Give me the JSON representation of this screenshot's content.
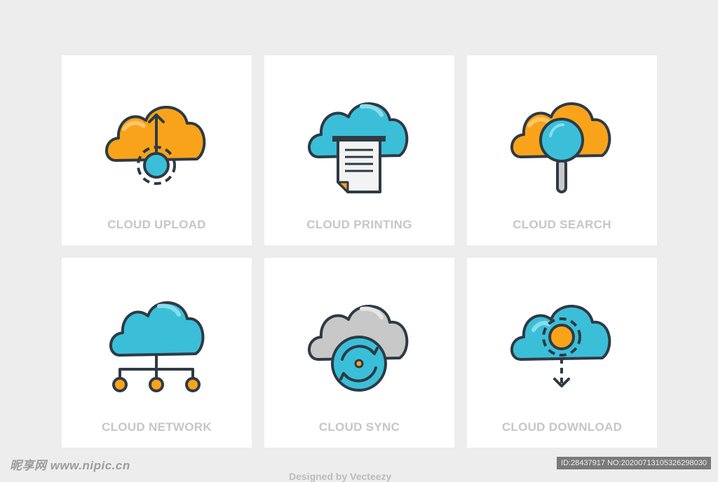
{
  "cards": [
    {
      "label": "CLOUD UPLOAD",
      "icon": "cloud-upload-icon"
    },
    {
      "label": "CLOUD PRINTING",
      "icon": "cloud-printing-icon"
    },
    {
      "label": "CLOUD SEARCH",
      "icon": "cloud-search-icon"
    },
    {
      "label": "CLOUD NETWORK",
      "icon": "cloud-network-icon"
    },
    {
      "label": "CLOUD SYNC",
      "icon": "cloud-sync-icon"
    },
    {
      "label": "CLOUD DOWNLOAD",
      "icon": "cloud-download-icon"
    }
  ],
  "watermark": {
    "site": "昵享网 www.nipic.cn",
    "image_id": "ID:28437917 NO:20200713105326298030",
    "credit": "Designed by Vecteezy"
  },
  "colors": {
    "orange": "#f9a31b",
    "blue": "#3bbfd9",
    "gray": "#c8c8c8",
    "outline": "#2e3a44",
    "label": "#c6c6c6",
    "background": "#ededee"
  }
}
